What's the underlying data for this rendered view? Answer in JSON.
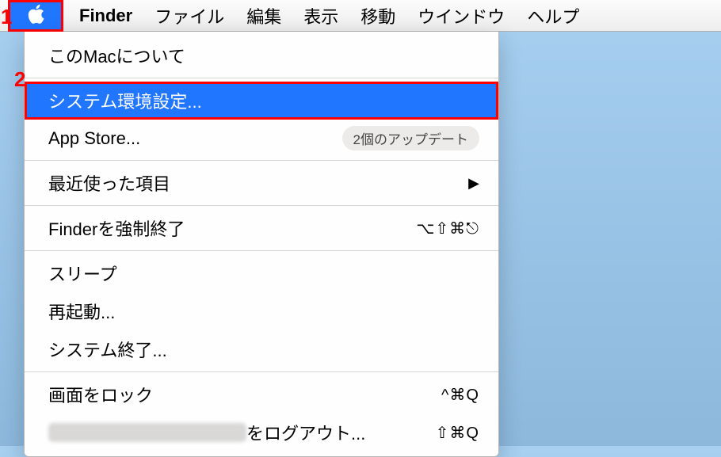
{
  "annotations": {
    "a1": "1",
    "a2": "2"
  },
  "menubar": {
    "app": "Finder",
    "items": [
      "ファイル",
      "編集",
      "表示",
      "移動",
      "ウインドウ",
      "ヘルプ"
    ]
  },
  "dropdown": {
    "about": "このMacについて",
    "syspref": "システム環境設定...",
    "appstore": "App Store...",
    "appstore_badge": "2個のアップデート",
    "recent": "最近使った項目",
    "forcequit": "Finderを強制終了",
    "forcequit_sc": "⌥⇧⌘⎋",
    "sleep": "スリープ",
    "restart": "再起動...",
    "shutdown": "システム終了...",
    "lock": "画面をロック",
    "lock_sc": "^⌘Q",
    "logout_suffix": "をログアウト...",
    "logout_sc": "⇧⌘Q"
  }
}
